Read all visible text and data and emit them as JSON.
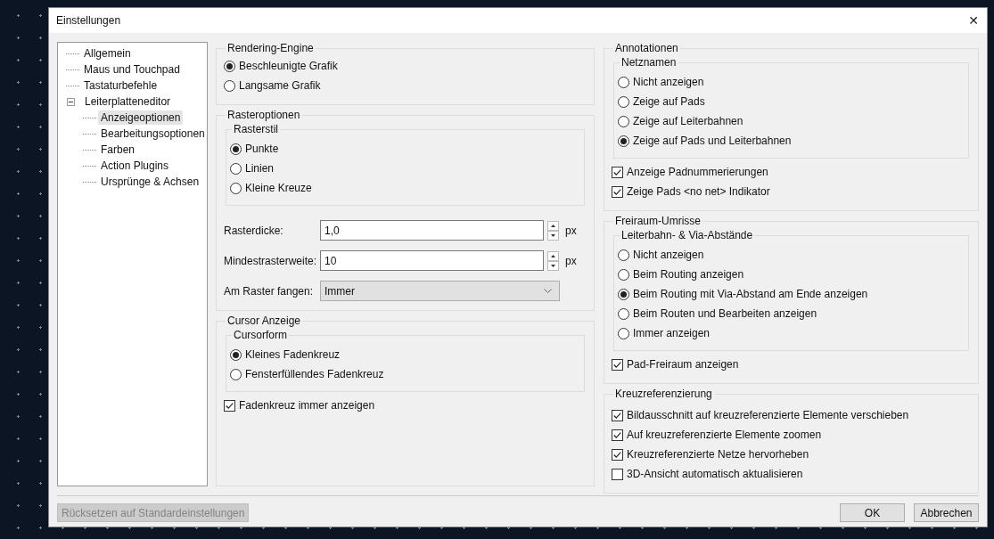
{
  "window": {
    "title": "Einstellungen",
    "close": "✕"
  },
  "tree": [
    {
      "label": "Allgemein",
      "selected": false
    },
    {
      "label": "Maus und Touchpad",
      "selected": false
    },
    {
      "label": "Tastaturbefehle",
      "selected": false
    },
    {
      "label": "Leiterplatteneditor",
      "selected": false,
      "expanded": true,
      "children": [
        {
          "label": "Anzeigeoptionen",
          "selected": true
        },
        {
          "label": "Bearbeitungsoptionen",
          "selected": false
        },
        {
          "label": "Farben",
          "selected": false
        },
        {
          "label": "Action Plugins",
          "selected": false
        },
        {
          "label": "Ursprünge & Achsen",
          "selected": false
        }
      ]
    }
  ],
  "columns": [
    [
      {
        "title": "Rendering-Engine",
        "options": [
          {
            "label": "Beschleunigte Grafik",
            "selected": true
          },
          {
            "label": "Langsame Grafik",
            "selected": false
          }
        ]
      },
      {
        "title": "Rasteroptionen",
        "subgroup": {
          "title": "Rasterstil",
          "options": [
            {
              "label": "Punkte",
              "selected": true
            },
            {
              "label": "Linien",
              "selected": false
            },
            {
              "label": "Kleine Kreuze",
              "selected": false
            }
          ]
        },
        "fields": [
          {
            "kind": "spin",
            "label": "Rasterdicke:",
            "value": "1,0",
            "unit": "px"
          },
          {
            "kind": "spin",
            "label": "Mindestrasterweite:",
            "value": "10",
            "unit": "px"
          },
          {
            "kind": "dropdown",
            "label": "Am Raster fangen:",
            "value": "Immer"
          }
        ]
      },
      {
        "title": "Cursor Anzeige",
        "subgroup": {
          "title": "Cursorform",
          "options": [
            {
              "label": "Kleines Fadenkreuz",
              "selected": true
            },
            {
              "label": "Fensterfüllendes Fadenkreuz",
              "selected": false
            }
          ]
        },
        "checkboxes": [
          {
            "label": "Fadenkreuz immer anzeigen",
            "checked": true
          }
        ]
      }
    ],
    [
      {
        "title": "Annotationen",
        "subgroup": {
          "title": "Netznamen",
          "options": [
            {
              "label": "Nicht anzeigen",
              "selected": false
            },
            {
              "label": "Zeige auf Pads",
              "selected": false
            },
            {
              "label": "Zeige auf Leiterbahnen",
              "selected": false
            },
            {
              "label": "Zeige auf Pads und Leiterbahnen",
              "selected": true
            }
          ]
        },
        "checkboxes": [
          {
            "label": "Anzeige Padnummerierungen",
            "checked": true
          },
          {
            "label": "Zeige Pads <no net> Indikator",
            "checked": true
          }
        ]
      },
      {
        "title": "Freiraum-Umrisse",
        "subgroup": {
          "title": "Leiterbahn- & Via-Abstände",
          "options": [
            {
              "label": "Nicht anzeigen",
              "selected": false
            },
            {
              "label": "Beim Routing anzeigen",
              "selected": false
            },
            {
              "label": "Beim Routing mit Via-Abstand am Ende anzeigen",
              "selected": true
            },
            {
              "label": "Beim Routen und Bearbeiten anzeigen",
              "selected": false
            },
            {
              "label": "Immer anzeigen",
              "selected": false
            }
          ]
        },
        "checkboxes": [
          {
            "label": "Pad-Freiraum anzeigen",
            "checked": true
          }
        ]
      },
      {
        "title": "Kreuzreferenzierung",
        "checkboxes": [
          {
            "label": "Bildausschnitt auf kreuzreferenzierte Elemente verschieben",
            "checked": true
          },
          {
            "label": "Auf kreuzreferenzierte Elemente zoomen",
            "checked": true
          },
          {
            "label": "Kreuzreferenzierte Netze hervorheben",
            "checked": true
          },
          {
            "label": "3D-Ansicht automatisch aktualisieren",
            "checked": false
          }
        ]
      }
    ]
  ],
  "footer": {
    "reset": {
      "label": "Rücksetzen auf Standardeinstellungen",
      "disabled": true
    },
    "buttons": [
      "OK",
      "Abbrechen"
    ]
  }
}
